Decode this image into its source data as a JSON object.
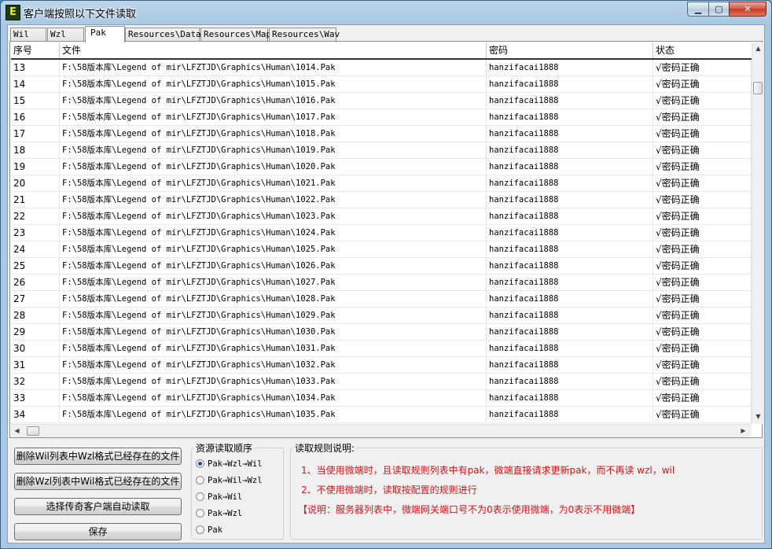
{
  "window": {
    "title": "客户端按照以下文件读取",
    "icon_letter": "E",
    "min_label": "▁",
    "max_label": "▢",
    "close_label": "✕"
  },
  "tabs": [
    {
      "label": "Wil",
      "active": false
    },
    {
      "label": "Wzl",
      "active": false
    },
    {
      "label": "Pak",
      "active": true
    },
    {
      "label": "Resources\\Data",
      "active": false
    },
    {
      "label": "Resources\\Map",
      "active": false
    },
    {
      "label": "Resources\\Wav",
      "active": false
    }
  ],
  "table": {
    "columns": [
      "序号",
      "文件",
      "密码",
      "状态"
    ],
    "rows": [
      {
        "no": "13",
        "file": "F:\\58版本库\\Legend of mir\\LFZTJD\\Graphics\\Human\\1014.Pak",
        "password": "hanzifacai1888",
        "status": "√密码正确"
      },
      {
        "no": "14",
        "file": "F:\\58版本库\\Legend of mir\\LFZTJD\\Graphics\\Human\\1015.Pak",
        "password": "hanzifacai1888",
        "status": "√密码正确"
      },
      {
        "no": "15",
        "file": "F:\\58版本库\\Legend of mir\\LFZTJD\\Graphics\\Human\\1016.Pak",
        "password": "hanzifacai1888",
        "status": "√密码正确"
      },
      {
        "no": "16",
        "file": "F:\\58版本库\\Legend of mir\\LFZTJD\\Graphics\\Human\\1017.Pak",
        "password": "hanzifacai1888",
        "status": "√密码正确"
      },
      {
        "no": "17",
        "file": "F:\\58版本库\\Legend of mir\\LFZTJD\\Graphics\\Human\\1018.Pak",
        "password": "hanzifacai1888",
        "status": "√密码正确"
      },
      {
        "no": "18",
        "file": "F:\\58版本库\\Legend of mir\\LFZTJD\\Graphics\\Human\\1019.Pak",
        "password": "hanzifacai1888",
        "status": "√密码正确"
      },
      {
        "no": "19",
        "file": "F:\\58版本库\\Legend of mir\\LFZTJD\\Graphics\\Human\\1020.Pak",
        "password": "hanzifacai1888",
        "status": "√密码正确"
      },
      {
        "no": "20",
        "file": "F:\\58版本库\\Legend of mir\\LFZTJD\\Graphics\\Human\\1021.Pak",
        "password": "hanzifacai1888",
        "status": "√密码正确"
      },
      {
        "no": "21",
        "file": "F:\\58版本库\\Legend of mir\\LFZTJD\\Graphics\\Human\\1022.Pak",
        "password": "hanzifacai1888",
        "status": "√密码正确"
      },
      {
        "no": "22",
        "file": "F:\\58版本库\\Legend of mir\\LFZTJD\\Graphics\\Human\\1023.Pak",
        "password": "hanzifacai1888",
        "status": "√密码正确"
      },
      {
        "no": "23",
        "file": "F:\\58版本库\\Legend of mir\\LFZTJD\\Graphics\\Human\\1024.Pak",
        "password": "hanzifacai1888",
        "status": "√密码正确"
      },
      {
        "no": "24",
        "file": "F:\\58版本库\\Legend of mir\\LFZTJD\\Graphics\\Human\\1025.Pak",
        "password": "hanzifacai1888",
        "status": "√密码正确"
      },
      {
        "no": "25",
        "file": "F:\\58版本库\\Legend of mir\\LFZTJD\\Graphics\\Human\\1026.Pak",
        "password": "hanzifacai1888",
        "status": "√密码正确"
      },
      {
        "no": "26",
        "file": "F:\\58版本库\\Legend of mir\\LFZTJD\\Graphics\\Human\\1027.Pak",
        "password": "hanzifacai1888",
        "status": "√密码正确"
      },
      {
        "no": "27",
        "file": "F:\\58版本库\\Legend of mir\\LFZTJD\\Graphics\\Human\\1028.Pak",
        "password": "hanzifacai1888",
        "status": "√密码正确"
      },
      {
        "no": "28",
        "file": "F:\\58版本库\\Legend of mir\\LFZTJD\\Graphics\\Human\\1029.Pak",
        "password": "hanzifacai1888",
        "status": "√密码正确"
      },
      {
        "no": "29",
        "file": "F:\\58版本库\\Legend of mir\\LFZTJD\\Graphics\\Human\\1030.Pak",
        "password": "hanzifacai1888",
        "status": "√密码正确"
      },
      {
        "no": "30",
        "file": "F:\\58版本库\\Legend of mir\\LFZTJD\\Graphics\\Human\\1031.Pak",
        "password": "hanzifacai1888",
        "status": "√密码正确"
      },
      {
        "no": "31",
        "file": "F:\\58版本库\\Legend of mir\\LFZTJD\\Graphics\\Human\\1032.Pak",
        "password": "hanzifacai1888",
        "status": "√密码正确"
      },
      {
        "no": "32",
        "file": "F:\\58版本库\\Legend of mir\\LFZTJD\\Graphics\\Human\\1033.Pak",
        "password": "hanzifacai1888",
        "status": "√密码正确"
      },
      {
        "no": "33",
        "file": "F:\\58版本库\\Legend of mir\\LFZTJD\\Graphics\\Human\\1034.Pak",
        "password": "hanzifacai1888",
        "status": "√密码正确"
      },
      {
        "no": "34",
        "file": "F:\\58版本库\\Legend of mir\\LFZTJD\\Graphics\\Human\\1035.Pak",
        "password": "hanzifacai1888",
        "status": "√密码正确"
      }
    ]
  },
  "scroll": {
    "up": "▲",
    "down": "▼",
    "left": "◀",
    "right": "▶"
  },
  "buttons": {
    "delete_wil": "删除Wil列表中Wzl格式已经存在的文件",
    "delete_wzl": "删除Wzl列表中Wil格式已经存在的文件",
    "choose_client": "选择传奇客户端自动读取",
    "save": "保存"
  },
  "order_group": {
    "title": "资源读取顺序",
    "options": [
      {
        "label": "Pak→Wzl→Wil",
        "selected": true
      },
      {
        "label": "Pak→Wil→Wzl",
        "selected": false
      },
      {
        "label": "Pak→Wil",
        "selected": false
      },
      {
        "label": "Pak→Wzl",
        "selected": false
      },
      {
        "label": "Pak",
        "selected": false
      }
    ]
  },
  "rules_group": {
    "title": "读取规则说明:",
    "line1": "1、当使用微端时，且读取规则列表中有pak，微端直接请求更新pak，而不再读 wzl，wil",
    "line2": "2、不使用微端时，读取按配置的规则进行",
    "line3": "【说明：服务器列表中，微端网关端口号不为0表示使用微端，为0表示不用微端】"
  },
  "colors": {
    "rule_text": "#d2161b",
    "title_bar": "#a9c8e3",
    "radio_dot": "#1b4fa8"
  }
}
